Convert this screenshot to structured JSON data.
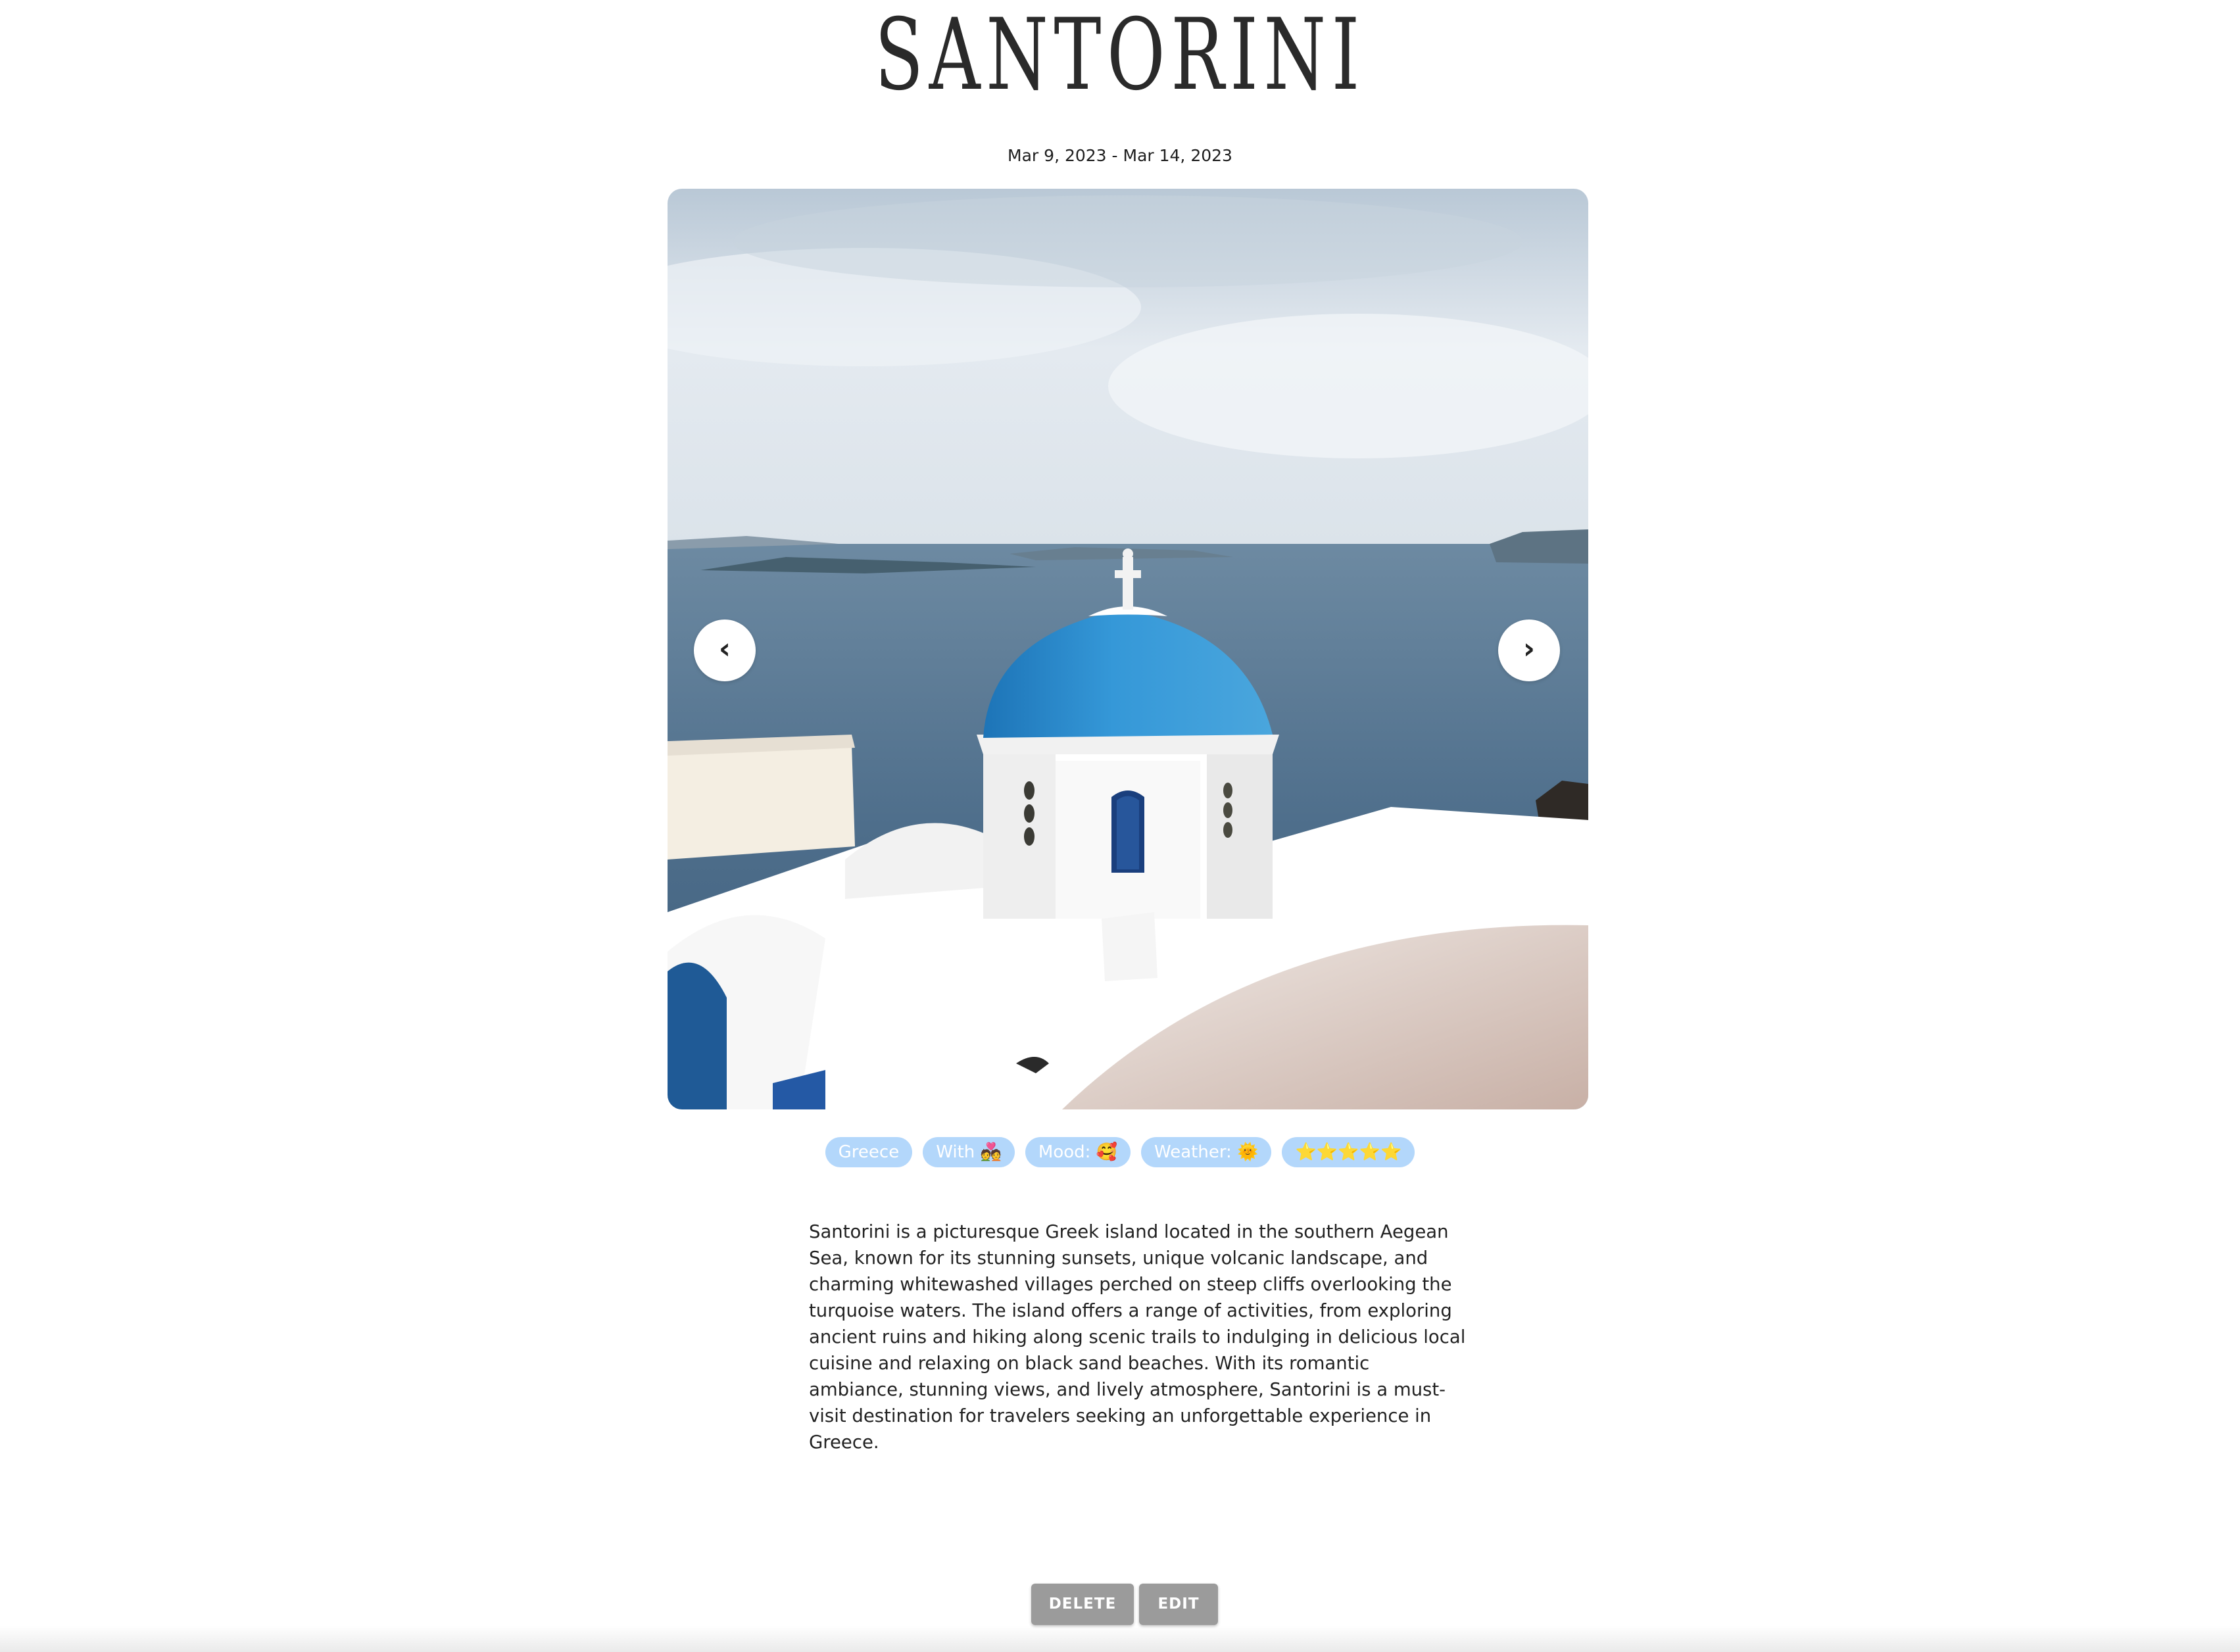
{
  "title": "SANTORINI",
  "date_range": "Mar 9, 2023 - Mar 14, 2023",
  "carousel": {
    "image_subject": "blue-domed white church overlooking the Aegean Sea",
    "prev_icon": "chevron-left-icon",
    "prev_glyph": "‹",
    "next_icon": "chevron-right-icon",
    "next_glyph": "›"
  },
  "tags": {
    "location": "Greece",
    "with": "With 💑",
    "mood": "Mood: 🥰",
    "weather": "Weather: 🌞",
    "rating": "⭐⭐⭐⭐⭐"
  },
  "description": "Santorini is a picturesque Greek island located in the southern Aegean Sea, known for its stunning sunsets, unique volcanic landscape, and charming whitewashed villages perched on steep cliffs overlooking the turquoise waters. The island offers a range of activities, from exploring ancient ruins and hiking along scenic trails to indulging in delicious local cuisine and relaxing on black sand beaches. With its romantic ambiance, stunning views, and lively atmosphere, Santorini is a must-visit destination for travelers seeking an unforgettable experience in Greece.",
  "actions": {
    "delete_label": "DELETE",
    "edit_label": "EDIT"
  },
  "colors": {
    "tag_background": "#b3d7fb",
    "button_background": "#9b9b9b",
    "dome_blue": "#2e8fd0"
  }
}
